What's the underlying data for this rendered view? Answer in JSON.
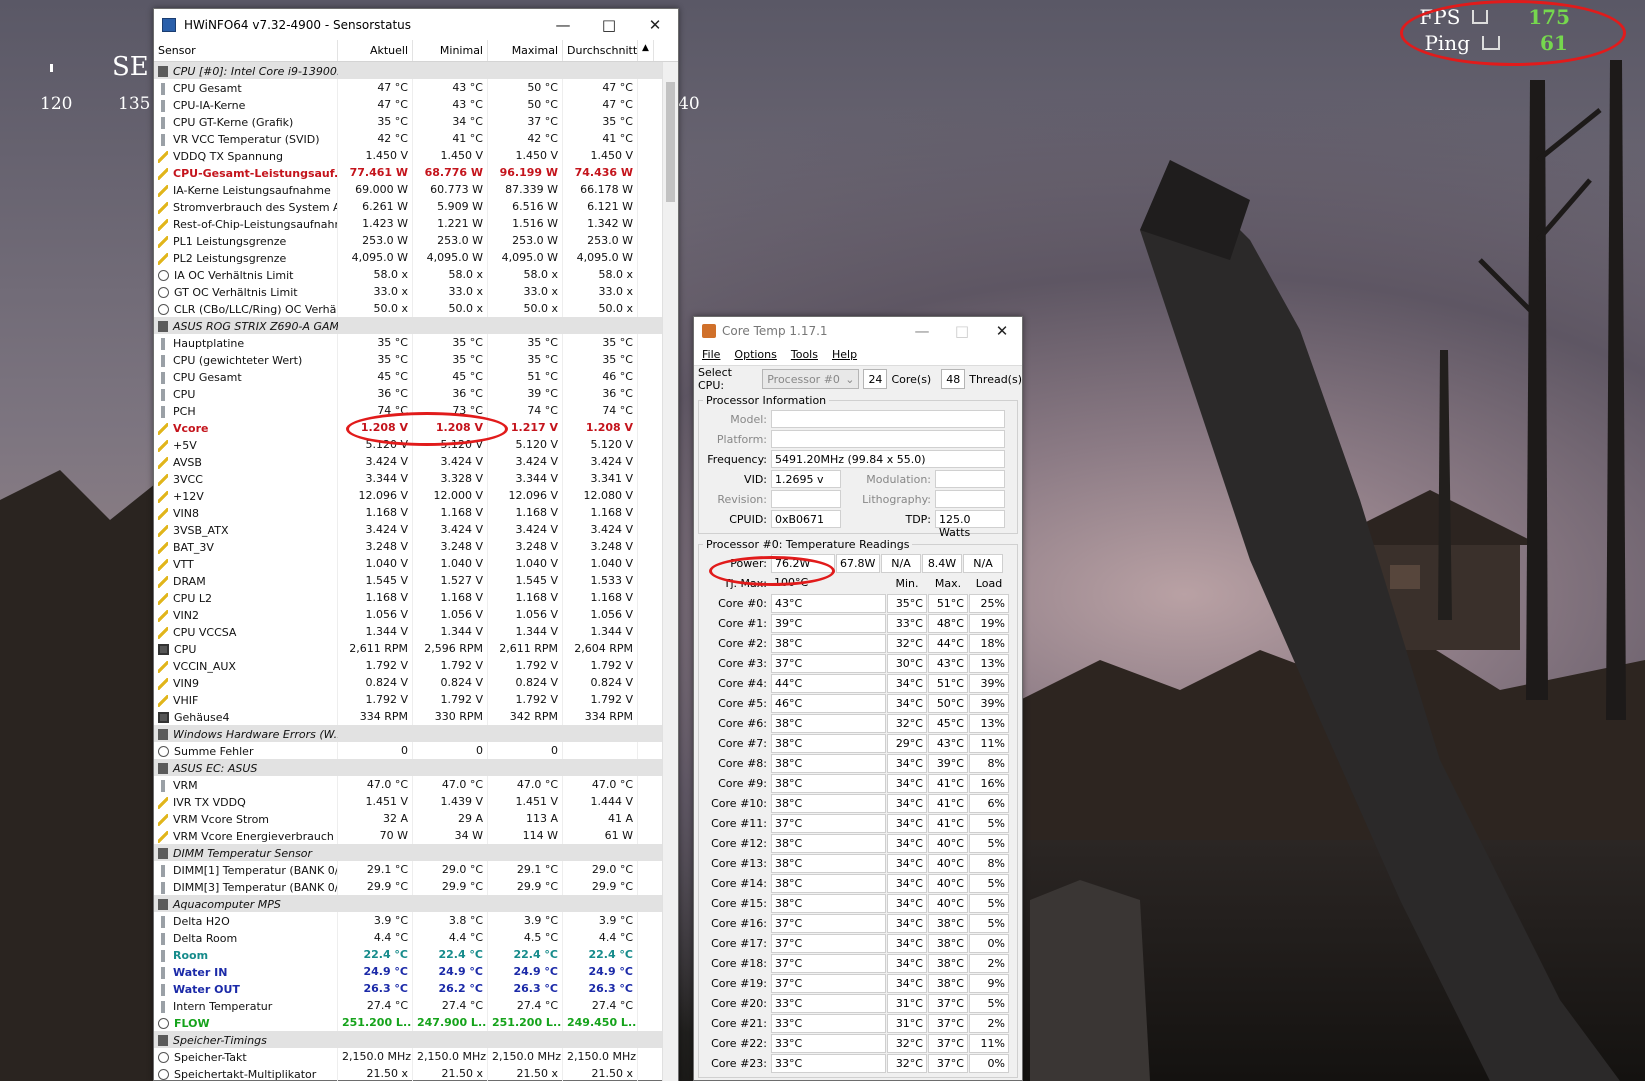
{
  "overlay": {
    "compass_dir": "SE",
    "compass_ticks": [
      "120",
      "135",
      "40"
    ],
    "fps_label": "FPS",
    "fps_value": "175",
    "ping_label": "Ping",
    "ping_value": "61"
  },
  "hwinfo": {
    "title": "HWiNFO64 v7.32-4900 - Sensorstatus",
    "columns": [
      "Sensor",
      "Aktuell",
      "Minimal",
      "Maximal",
      "Durchschnitt"
    ],
    "rows": [
      {
        "type": "group",
        "icon": "group-ico",
        "name": "CPU [#0]: Intel Core i9-13900..."
      },
      {
        "icon": "temp",
        "name": "CPU Gesamt",
        "v": [
          "47 °C",
          "43 °C",
          "50 °C",
          "47 °C"
        ]
      },
      {
        "icon": "temp",
        "name": "CPU-IA-Kerne",
        "v": [
          "47 °C",
          "43 °C",
          "50 °C",
          "47 °C"
        ]
      },
      {
        "icon": "temp",
        "name": "CPU GT-Kerne (Grafik)",
        "v": [
          "35 °C",
          "34 °C",
          "37 °C",
          "35 °C"
        ]
      },
      {
        "icon": "temp",
        "name": "VR VCC Temperatur (SVID)",
        "v": [
          "42 °C",
          "41 °C",
          "42 °C",
          "41 °C"
        ]
      },
      {
        "icon": "volt",
        "name": "VDDQ TX Spannung",
        "v": [
          "1.450 V",
          "1.450 V",
          "1.450 V",
          "1.450 V"
        ]
      },
      {
        "icon": "power",
        "style": "red",
        "name": "CPU-Gesamt-Leistungsauf...",
        "v": [
          "77.461 W",
          "68.776 W",
          "96.199 W",
          "74.436 W"
        ]
      },
      {
        "icon": "power",
        "name": "IA-Kerne Leistungsaufnahme",
        "v": [
          "69.000 W",
          "60.773 W",
          "87.339 W",
          "66.178 W"
        ]
      },
      {
        "icon": "power",
        "name": "Stromverbrauch des System A...",
        "v": [
          "6.261 W",
          "5.909 W",
          "6.516 W",
          "6.121 W"
        ]
      },
      {
        "icon": "power",
        "name": "Rest-of-Chip-Leistungsaufnahme",
        "v": [
          "1.423 W",
          "1.221 W",
          "1.516 W",
          "1.342 W"
        ]
      },
      {
        "icon": "power",
        "name": "PL1 Leistungsgrenze",
        "v": [
          "253.0 W",
          "253.0 W",
          "253.0 W",
          "253.0 W"
        ]
      },
      {
        "icon": "power",
        "name": "PL2 Leistungsgrenze",
        "v": [
          "4,095.0 W",
          "4,095.0 W",
          "4,095.0 W",
          "4,095.0 W"
        ]
      },
      {
        "icon": "clock",
        "name": "IA OC Verhältnis Limit",
        "v": [
          "58.0 x",
          "58.0 x",
          "58.0 x",
          "58.0 x"
        ]
      },
      {
        "icon": "clock",
        "name": "GT OC Verhältnis Limit",
        "v": [
          "33.0 x",
          "33.0 x",
          "33.0 x",
          "33.0 x"
        ]
      },
      {
        "icon": "clock",
        "name": "CLR (CBo/LLC/Ring) OC Verhäl...",
        "v": [
          "50.0 x",
          "50.0 x",
          "50.0 x",
          "50.0 x"
        ]
      },
      {
        "type": "group",
        "icon": "group-ico",
        "name": "ASUS ROG STRIX Z690-A GAM..."
      },
      {
        "icon": "temp",
        "name": "Hauptplatine",
        "v": [
          "35 °C",
          "35 °C",
          "35 °C",
          "35 °C"
        ]
      },
      {
        "icon": "temp",
        "name": "CPU (gewichteter Wert)",
        "v": [
          "35 °C",
          "35 °C",
          "35 °C",
          "35 °C"
        ]
      },
      {
        "icon": "temp",
        "name": "CPU Gesamt",
        "v": [
          "45 °C",
          "45 °C",
          "51 °C",
          "46 °C"
        ]
      },
      {
        "icon": "temp",
        "name": "CPU",
        "v": [
          "36 °C",
          "36 °C",
          "39 °C",
          "36 °C"
        ]
      },
      {
        "icon": "temp",
        "name": "PCH",
        "v": [
          "74 °C",
          "73 °C",
          "74 °C",
          "74 °C"
        ]
      },
      {
        "icon": "volt",
        "style": "red",
        "name": "Vcore",
        "v": [
          "1.208 V",
          "1.208 V",
          "1.217 V",
          "1.208 V"
        ]
      },
      {
        "icon": "volt",
        "name": "+5V",
        "v": [
          "5.120 V",
          "5.120 V",
          "5.120 V",
          "5.120 V"
        ]
      },
      {
        "icon": "volt",
        "name": "AVSB",
        "v": [
          "3.424 V",
          "3.424 V",
          "3.424 V",
          "3.424 V"
        ]
      },
      {
        "icon": "volt",
        "name": "3VCC",
        "v": [
          "3.344 V",
          "3.328 V",
          "3.344 V",
          "3.341 V"
        ]
      },
      {
        "icon": "volt",
        "name": "+12V",
        "v": [
          "12.096 V",
          "12.000 V",
          "12.096 V",
          "12.080 V"
        ]
      },
      {
        "icon": "volt",
        "name": "VIN8",
        "v": [
          "1.168 V",
          "1.168 V",
          "1.168 V",
          "1.168 V"
        ]
      },
      {
        "icon": "volt",
        "name": "3VSB_ATX",
        "v": [
          "3.424 V",
          "3.424 V",
          "3.424 V",
          "3.424 V"
        ]
      },
      {
        "icon": "volt",
        "name": "BAT_3V",
        "v": [
          "3.248 V",
          "3.248 V",
          "3.248 V",
          "3.248 V"
        ]
      },
      {
        "icon": "volt",
        "name": "VTT",
        "v": [
          "1.040 V",
          "1.040 V",
          "1.040 V",
          "1.040 V"
        ]
      },
      {
        "icon": "volt",
        "name": "DRAM",
        "v": [
          "1.545 V",
          "1.527 V",
          "1.545 V",
          "1.533 V"
        ]
      },
      {
        "icon": "volt",
        "name": "CPU L2",
        "v": [
          "1.168 V",
          "1.168 V",
          "1.168 V",
          "1.168 V"
        ]
      },
      {
        "icon": "volt",
        "name": "VIN2",
        "v": [
          "1.056 V",
          "1.056 V",
          "1.056 V",
          "1.056 V"
        ]
      },
      {
        "icon": "volt",
        "name": "CPU VCCSA",
        "v": [
          "1.344 V",
          "1.344 V",
          "1.344 V",
          "1.344 V"
        ]
      },
      {
        "icon": "fan",
        "name": "CPU",
        "v": [
          "2,611 RPM",
          "2,596 RPM",
          "2,611 RPM",
          "2,604 RPM"
        ]
      },
      {
        "icon": "volt",
        "name": "VCCIN_AUX",
        "v": [
          "1.792 V",
          "1.792 V",
          "1.792 V",
          "1.792 V"
        ]
      },
      {
        "icon": "volt",
        "name": "VIN9",
        "v": [
          "0.824 V",
          "0.824 V",
          "0.824 V",
          "0.824 V"
        ]
      },
      {
        "icon": "volt",
        "name": "VHIF",
        "v": [
          "1.792 V",
          "1.792 V",
          "1.792 V",
          "1.792 V"
        ]
      },
      {
        "icon": "fan",
        "name": "Gehäuse4",
        "v": [
          "334 RPM",
          "330 RPM",
          "342 RPM",
          "334 RPM"
        ]
      },
      {
        "type": "group",
        "icon": "group-ico",
        "name": "Windows Hardware Errors (W..."
      },
      {
        "icon": "clock",
        "name": "Summe Fehler",
        "v": [
          "0",
          "0",
          "0",
          ""
        ]
      },
      {
        "type": "group",
        "icon": "group-ico",
        "name": "ASUS EC: ASUS"
      },
      {
        "icon": "temp",
        "name": "VRM",
        "v": [
          "47.0 °C",
          "47.0 °C",
          "47.0 °C",
          "47.0 °C"
        ]
      },
      {
        "icon": "volt",
        "name": "IVR TX VDDQ",
        "v": [
          "1.451 V",
          "1.439 V",
          "1.451 V",
          "1.444 V"
        ]
      },
      {
        "icon": "volt",
        "name": "VRM Vcore Strom",
        "v": [
          "32 A",
          "29 A",
          "113 A",
          "41 A"
        ]
      },
      {
        "icon": "power",
        "name": "VRM Vcore Energieverbrauch",
        "v": [
          "70 W",
          "34 W",
          "114 W",
          "61 W"
        ]
      },
      {
        "type": "group",
        "icon": "group-ico",
        "name": "DIMM Temperatur Sensor"
      },
      {
        "icon": "temp",
        "name": "DIMM[1] Temperatur (BANK 0/...",
        "v": [
          "29.1 °C",
          "29.0 °C",
          "29.1 °C",
          "29.0 °C"
        ]
      },
      {
        "icon": "temp",
        "name": "DIMM[3] Temperatur (BANK 0/...",
        "v": [
          "29.9 °C",
          "29.9 °C",
          "29.9 °C",
          "29.9 °C"
        ]
      },
      {
        "type": "group",
        "icon": "group-ico",
        "name": "Aquacomputer MPS"
      },
      {
        "icon": "temp",
        "name": "Delta H2O",
        "v": [
          "3.9 °C",
          "3.8 °C",
          "3.9 °C",
          "3.9 °C"
        ]
      },
      {
        "icon": "temp",
        "name": "Delta Room",
        "v": [
          "4.4 °C",
          "4.4 °C",
          "4.5 °C",
          "4.4 °C"
        ]
      },
      {
        "icon": "temp",
        "style": "teal",
        "name": "Room",
        "v": [
          "22.4 °C",
          "22.4 °C",
          "22.4 °C",
          "22.4 °C"
        ]
      },
      {
        "icon": "temp",
        "style": "blue",
        "name": "Water IN",
        "v": [
          "24.9 °C",
          "24.9 °C",
          "24.9 °C",
          "24.9 °C"
        ]
      },
      {
        "icon": "temp",
        "style": "blue",
        "name": "Water OUT",
        "v": [
          "26.3 °C",
          "26.2 °C",
          "26.3 °C",
          "26.3 °C"
        ]
      },
      {
        "icon": "temp",
        "name": "Intern Temperatur",
        "v": [
          "27.4 °C",
          "27.4 °C",
          "27.4 °C",
          "27.4 °C"
        ]
      },
      {
        "icon": "clock",
        "style": "green",
        "name": "FLOW",
        "v": [
          "251.200 L...",
          "247.900 L...",
          "251.200 L...",
          "249.450 L..."
        ]
      },
      {
        "type": "group",
        "icon": "group-ico",
        "name": "Speicher-Timings"
      },
      {
        "icon": "clock",
        "name": "Speicher-Takt",
        "v": [
          "2,150.0 MHz",
          "2,150.0 MHz",
          "2,150.0 MHz",
          "2,150.0 MHz"
        ]
      },
      {
        "icon": "clock",
        "name": "Speichertakt-Multiplikator",
        "v": [
          "21.50 x",
          "21.50 x",
          "21.50 x",
          "21.50 x"
        ]
      }
    ]
  },
  "coretemp": {
    "title": "Core Temp 1.17.1",
    "menu": [
      "File",
      "Options",
      "Tools",
      "Help"
    ],
    "select_cpu_label": "Select CPU:",
    "select_cpu_value": "Processor #0",
    "cores_value": "24",
    "cores_label": "Core(s)",
    "threads_value": "48",
    "threads_label": "Thread(s)",
    "proc_info_legend": "Processor Information",
    "model_label": "Model:",
    "model_value": "",
    "platform_label": "Platform:",
    "platform_value": "",
    "frequency_label": "Frequency:",
    "frequency_value": "5491.20MHz (99.84 x 55.0)",
    "vid_label": "VID:",
    "vid_value": "1.2695 v",
    "modulation_label": "Modulation:",
    "modulation_value": "",
    "revision_label": "Revision:",
    "revision_value": "",
    "lithography_label": "Lithography:",
    "lithography_value": "",
    "cpuid_label": "CPUID:",
    "cpuid_value": "0xB0671",
    "tdp_label": "TDP:",
    "tdp_value": "125.0 Watts",
    "temp_legend": "Processor #0: Temperature Readings",
    "power_label": "Power:",
    "power_values": [
      "76.2W",
      "67.8W",
      "N/A",
      "8.4W",
      "N/A"
    ],
    "tjmax_label": "Tj. Max:",
    "tjmax_value": "100°C",
    "min_header": "Min.",
    "max_header": "Max.",
    "load_header": "Load",
    "cores": [
      {
        "label": "Core #0:",
        "cur": "43°C",
        "min": "35°C",
        "max": "51°C",
        "load": "25%"
      },
      {
        "label": "Core #1:",
        "cur": "39°C",
        "min": "33°C",
        "max": "48°C",
        "load": "19%"
      },
      {
        "label": "Core #2:",
        "cur": "38°C",
        "min": "32°C",
        "max": "44°C",
        "load": "18%"
      },
      {
        "label": "Core #3:",
        "cur": "37°C",
        "min": "30°C",
        "max": "43°C",
        "load": "13%"
      },
      {
        "label": "Core #4:",
        "cur": "44°C",
        "min": "34°C",
        "max": "51°C",
        "load": "39%"
      },
      {
        "label": "Core #5:",
        "cur": "46°C",
        "min": "34°C",
        "max": "50°C",
        "load": "39%"
      },
      {
        "label": "Core #6:",
        "cur": "38°C",
        "min": "32°C",
        "max": "45°C",
        "load": "13%"
      },
      {
        "label": "Core #7:",
        "cur": "38°C",
        "min": "29°C",
        "max": "43°C",
        "load": "11%"
      },
      {
        "label": "Core #8:",
        "cur": "38°C",
        "min": "34°C",
        "max": "39°C",
        "load": "8%"
      },
      {
        "label": "Core #9:",
        "cur": "38°C",
        "min": "34°C",
        "max": "41°C",
        "load": "16%"
      },
      {
        "label": "Core #10:",
        "cur": "38°C",
        "min": "34°C",
        "max": "41°C",
        "load": "6%"
      },
      {
        "label": "Core #11:",
        "cur": "37°C",
        "min": "34°C",
        "max": "41°C",
        "load": "5%"
      },
      {
        "label": "Core #12:",
        "cur": "38°C",
        "min": "34°C",
        "max": "40°C",
        "load": "5%"
      },
      {
        "label": "Core #13:",
        "cur": "38°C",
        "min": "34°C",
        "max": "40°C",
        "load": "8%"
      },
      {
        "label": "Core #14:",
        "cur": "38°C",
        "min": "34°C",
        "max": "40°C",
        "load": "5%"
      },
      {
        "label": "Core #15:",
        "cur": "38°C",
        "min": "34°C",
        "max": "40°C",
        "load": "5%"
      },
      {
        "label": "Core #16:",
        "cur": "37°C",
        "min": "34°C",
        "max": "38°C",
        "load": "5%"
      },
      {
        "label": "Core #17:",
        "cur": "37°C",
        "min": "34°C",
        "max": "38°C",
        "load": "0%"
      },
      {
        "label": "Core #18:",
        "cur": "37°C",
        "min": "34°C",
        "max": "38°C",
        "load": "2%"
      },
      {
        "label": "Core #19:",
        "cur": "37°C",
        "min": "34°C",
        "max": "38°C",
        "load": "9%"
      },
      {
        "label": "Core #20:",
        "cur": "33°C",
        "min": "31°C",
        "max": "37°C",
        "load": "5%"
      },
      {
        "label": "Core #21:",
        "cur": "33°C",
        "min": "31°C",
        "max": "37°C",
        "load": "2%"
      },
      {
        "label": "Core #22:",
        "cur": "33°C",
        "min": "32°C",
        "max": "37°C",
        "load": "11%"
      },
      {
        "label": "Core #23:",
        "cur": "33°C",
        "min": "32°C",
        "max": "37°C",
        "load": "0%"
      }
    ]
  }
}
